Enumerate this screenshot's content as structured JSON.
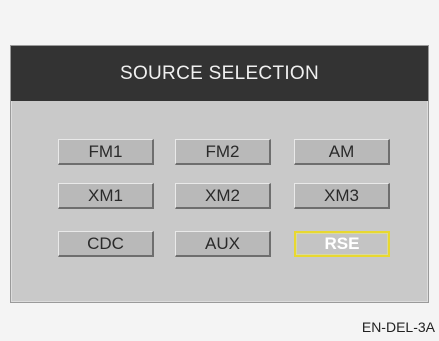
{
  "screen": {
    "title": "SOURCE SELECTION",
    "sources": [
      {
        "label": "FM1",
        "selected": false
      },
      {
        "label": "FM2",
        "selected": false
      },
      {
        "label": "AM",
        "selected": false
      },
      {
        "label": "XM1",
        "selected": false
      },
      {
        "label": "XM2",
        "selected": false
      },
      {
        "label": "XM3",
        "selected": false
      },
      {
        "label": "CDC",
        "selected": false
      },
      {
        "label": "AUX",
        "selected": false
      },
      {
        "label": "RSE",
        "selected": true
      }
    ],
    "selected_color": "#e8d830"
  },
  "caption": "EN-DEL-3A"
}
